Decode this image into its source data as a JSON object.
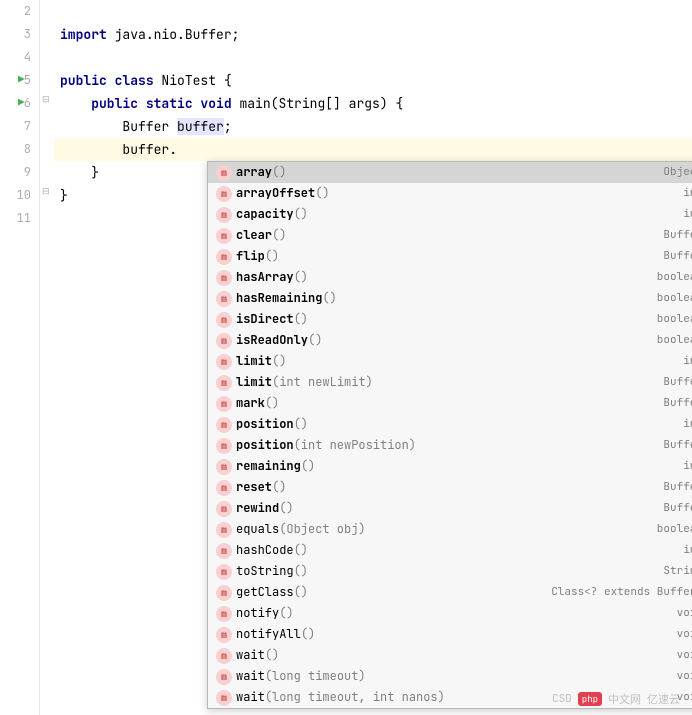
{
  "gutter": {
    "lines": [
      "2",
      "3",
      "4",
      "5",
      "6",
      "7",
      "8",
      "9",
      "10",
      "11"
    ],
    "runnable": [
      5,
      6
    ]
  },
  "code": {
    "line2": "",
    "line3_import": "import",
    "line3_pkg": " java.nio.Buffer;",
    "line4": "",
    "line5_public": "public",
    "line5_class": " class",
    "line5_name": " NioTest {",
    "line6_public": "    public",
    "line6_static": " static",
    "line6_void": " void",
    "line6_main": " main(String[] args) {",
    "line7_type": "        Buffer ",
    "line7_var": "buffer",
    "line7_semi": ";",
    "line8_var": "        buffer",
    "line8_dot": ".",
    "line9": "    }",
    "line10": "}",
    "line11": ""
  },
  "autocomplete": {
    "items": [
      {
        "name": "array",
        "params": "()",
        "ret": "Object",
        "bold": true,
        "selected": true
      },
      {
        "name": "arrayOffset",
        "params": "()",
        "ret": "int",
        "bold": true
      },
      {
        "name": "capacity",
        "params": "()",
        "ret": "int",
        "bold": true
      },
      {
        "name": "clear",
        "params": "()",
        "ret": "Buffer",
        "bold": true
      },
      {
        "name": "flip",
        "params": "()",
        "ret": "Buffer",
        "bold": true
      },
      {
        "name": "hasArray",
        "params": "()",
        "ret": "boolean",
        "bold": true
      },
      {
        "name": "hasRemaining",
        "params": "()",
        "ret": "boolean",
        "bold": true
      },
      {
        "name": "isDirect",
        "params": "()",
        "ret": "boolean",
        "bold": true
      },
      {
        "name": "isReadOnly",
        "params": "()",
        "ret": "boolean",
        "bold": true
      },
      {
        "name": "limit",
        "params": "()",
        "ret": "int",
        "bold": true
      },
      {
        "name": "limit",
        "params": "(int newLimit)",
        "ret": "Buffer",
        "bold": true
      },
      {
        "name": "mark",
        "params": "()",
        "ret": "Buffer",
        "bold": true
      },
      {
        "name": "position",
        "params": "()",
        "ret": "int",
        "bold": true
      },
      {
        "name": "position",
        "params": "(int newPosition)",
        "ret": "Buffer",
        "bold": true
      },
      {
        "name": "remaining",
        "params": "()",
        "ret": "int",
        "bold": true
      },
      {
        "name": "reset",
        "params": "()",
        "ret": "Buffer",
        "bold": true
      },
      {
        "name": "rewind",
        "params": "()",
        "ret": "Buffer",
        "bold": true
      },
      {
        "name": "equals",
        "params": "(Object obj)",
        "ret": "boolean",
        "bold": false
      },
      {
        "name": "hashCode",
        "params": "()",
        "ret": "int",
        "bold": false
      },
      {
        "name": "toString",
        "params": "()",
        "ret": "String",
        "bold": false
      },
      {
        "name": "getClass",
        "params": "()",
        "ret": "Class<? extends Buffer>",
        "bold": false
      },
      {
        "name": "notify",
        "params": "()",
        "ret": "void",
        "bold": false
      },
      {
        "name": "notifyAll",
        "params": "()",
        "ret": "void",
        "bold": false
      },
      {
        "name": "wait",
        "params": "()",
        "ret": "void",
        "bold": false
      },
      {
        "name": "wait",
        "params": "(long timeout)",
        "ret": "void",
        "bold": false
      },
      {
        "name": "wait",
        "params": "(long timeout, int nanos)",
        "ret": "void",
        "bold": false
      }
    ]
  },
  "watermark": {
    "badge": "php",
    "text1": "中文网",
    "text2": "CSD",
    "text3": "亿速云"
  }
}
